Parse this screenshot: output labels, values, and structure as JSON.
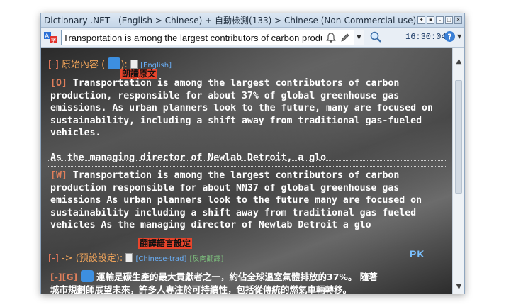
{
  "window": {
    "title": "Dictionary .NET - (English > Chinese) + 自動檢測(133) > Chinese (Non-Commercial use)"
  },
  "toolbar": {
    "query": "Transportation is among the largest contributors of carbon production",
    "clock": "16:30:04"
  },
  "original_section": {
    "toggle": "[-]",
    "label": "原始內容",
    "paren_open": "(",
    "paren_close": "):",
    "lang": "[English]",
    "annotation": "朗讀原文"
  },
  "paragraphs": [
    {
      "tag": "[O]",
      "text": " Transportation is among the largest contributors of carbon\nproduction, responsible for about 37% of global greenhouse gas\nemissions. As urban planners look to the future, many are focused on\nsustainability, including a shift away from traditional gas-fueled\nvehicles.\n\nAs the managing director of Newlab Detroit, a glo"
    },
    {
      "tag": "[W]",
      "text": " Transportation is among the largest contributors of carbon\nproduction responsible for about NN37 of global greenhouse gas\nemissions As urban planners look to the future many are focused on\nsustainability including a shift away from traditional gas fueled\nvehicles As the managing director of Newlab Detroit a glo"
    }
  ],
  "translate_section": {
    "annotation": "翻譯語言設定",
    "toggle": "[-]",
    "arrow": "->",
    "label": "(預設設定):",
    "lang": "[Chinese-trad]",
    "reverse": "[反向翻譯]"
  },
  "translation": {
    "tag": "[-][G]",
    "line1": "運輸是碳生產的最大貢獻者之一，約佔全球溫室氣體排放的37%。 隨著",
    "line2": "城市規劃師展望未來，許多人專注於可持續性，包括從傳統的燃氣車輛轉移。"
  },
  "watermark": "PK",
  "colors": {
    "accent_orange": "#f0a45a",
    "link_blue": "#6aaef5",
    "annotation_red": "#e8452c"
  }
}
